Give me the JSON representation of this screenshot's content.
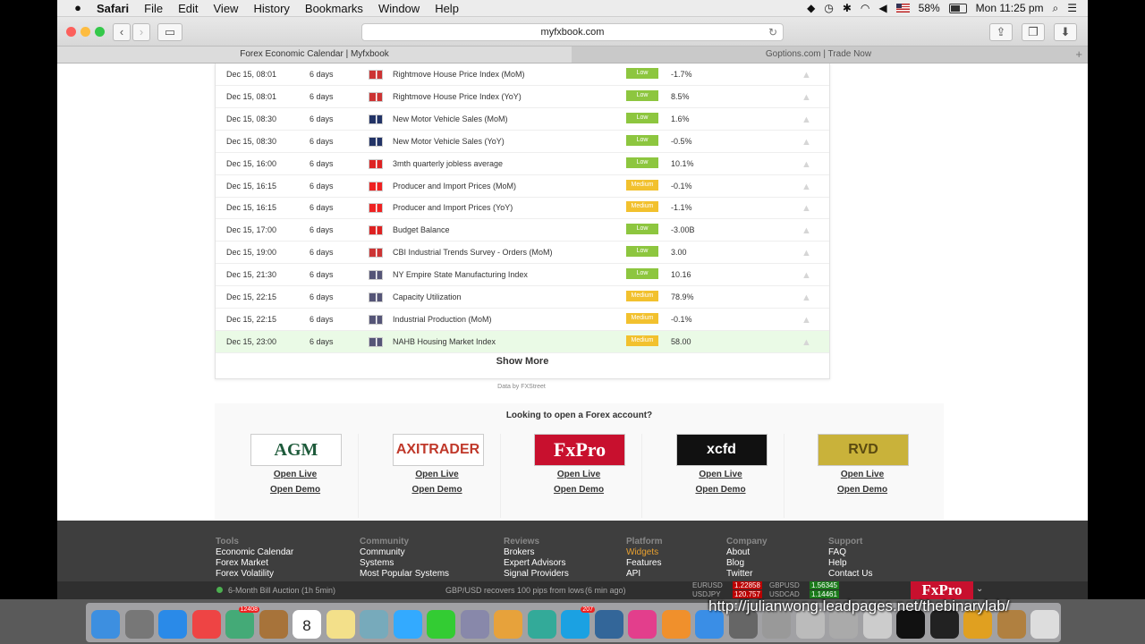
{
  "menubar": {
    "items": [
      "Safari",
      "File",
      "Edit",
      "View",
      "History",
      "Bookmarks",
      "Window",
      "Help"
    ],
    "battery": "58%",
    "clock": "Mon 11:25 pm"
  },
  "toolbar": {
    "url": "myfxbook.com"
  },
  "tabs": [
    "Forex Economic Calendar | Myfxbook",
    "Goptions.com | Trade Now"
  ],
  "calendar": {
    "rows": [
      {
        "date": "Dec 15, 08:01",
        "left": "6 days",
        "event": "Rightmove House Price Index (MoM)",
        "impact": "Low",
        "value": "-1.7%",
        "flag": "#c33"
      },
      {
        "date": "Dec 15, 08:01",
        "left": "6 days",
        "event": "Rightmove House Price Index (YoY)",
        "impact": "Low",
        "value": "8.5%",
        "flag": "#c33"
      },
      {
        "date": "Dec 15, 08:30",
        "left": "6 days",
        "event": "New Motor Vehicle Sales (MoM)",
        "impact": "Low",
        "value": "1.6%",
        "flag": "#236"
      },
      {
        "date": "Dec 15, 08:30",
        "left": "6 days",
        "event": "New Motor Vehicle Sales (YoY)",
        "impact": "Low",
        "value": "-0.5%",
        "flag": "#236"
      },
      {
        "date": "Dec 15, 16:00",
        "left": "6 days",
        "event": "3mth quarterly jobless average",
        "impact": "Low",
        "value": "10.1%",
        "flag": "#d22"
      },
      {
        "date": "Dec 15, 16:15",
        "left": "6 days",
        "event": "Producer and Import Prices (MoM)",
        "impact": "Medium",
        "value": "-0.1%",
        "flag": "#e22"
      },
      {
        "date": "Dec 15, 16:15",
        "left": "6 days",
        "event": "Producer and Import Prices (YoY)",
        "impact": "Medium",
        "value": "-1.1%",
        "flag": "#e22"
      },
      {
        "date": "Dec 15, 17:00",
        "left": "6 days",
        "event": "Budget Balance",
        "impact": "Low",
        "value": "-3.00B",
        "flag": "#d22"
      },
      {
        "date": "Dec 15, 19:00",
        "left": "6 days",
        "event": "CBI Industrial Trends Survey - Orders (MoM)",
        "impact": "Low",
        "value": "3.00",
        "flag": "#c33"
      },
      {
        "date": "Dec 15, 21:30",
        "left": "6 days",
        "event": "NY Empire State Manufacturing Index",
        "impact": "Low",
        "value": "10.16",
        "flag": "#557"
      },
      {
        "date": "Dec 15, 22:15",
        "left": "6 days",
        "event": "Capacity Utilization",
        "impact": "Medium",
        "value": "78.9%",
        "flag": "#557"
      },
      {
        "date": "Dec 15, 22:15",
        "left": "6 days",
        "event": "Industrial Production (MoM)",
        "impact": "Medium",
        "value": "-0.1%",
        "flag": "#557"
      },
      {
        "date": "Dec 15, 23:00",
        "left": "6 days",
        "event": "NAHB Housing Market Index",
        "impact": "Medium",
        "value": "58.00",
        "flag": "#557"
      }
    ],
    "show_more": "Show More",
    "data_by": "Data by FXStreet"
  },
  "colors": {
    "low": "#8dc63f",
    "medium": "#f2c12e"
  },
  "brokers": {
    "title": "Looking to open a Forex account?",
    "items": [
      {
        "name": "AGM",
        "logo_text": "AGM",
        "bg": "#ffffff",
        "fg": "#1d5a3a",
        "live": "Open Live",
        "demo": "Open Demo"
      },
      {
        "name": "AxiTrader",
        "logo_text": "AXITRADER",
        "bg": "#ffffff",
        "fg": "#c0392b",
        "live": "Open Live",
        "demo": "Open Demo"
      },
      {
        "name": "FxPro",
        "logo_text": "FxPro",
        "bg": "#c8102e",
        "fg": "#ffffff",
        "live": "Open Live",
        "demo": "Open Demo"
      },
      {
        "name": "xcfd",
        "logo_text": "xcfd",
        "bg": "#111111",
        "fg": "#ffffff",
        "live": "Open Live",
        "demo": "Open Demo"
      },
      {
        "name": "RVD",
        "logo_text": "RVD",
        "bg": "#c9b23a",
        "fg": "#5a4a10",
        "live": "Open Live",
        "demo": "Open Demo"
      }
    ]
  },
  "footer": {
    "cols": [
      {
        "heading": "Tools",
        "links": [
          "Economic Calendar",
          "Forex Market",
          "Forex Volatility"
        ]
      },
      {
        "heading": "Community",
        "links": [
          "Community",
          "Systems",
          "Most Popular Systems"
        ]
      },
      {
        "heading": "Reviews",
        "links": [
          "Brokers",
          "Expert Advisors",
          "Signal Providers"
        ]
      },
      {
        "heading": "Platform",
        "links": [
          "Widgets",
          "Features",
          "API"
        ]
      },
      {
        "heading": "Company",
        "links": [
          "About",
          "Blog",
          "Twitter"
        ]
      },
      {
        "heading": "Support",
        "links": [
          "FAQ",
          "Help",
          "Contact Us"
        ]
      }
    ]
  },
  "ticker": {
    "news1": "6-Month Bill Auction (1h 5min)",
    "news2": "GBP/USD recovers 100 pips from lows",
    "news2_time": "(6 min ago)",
    "pairs": [
      {
        "name": "EURUSD",
        "value": "1.22858",
        "trend": "down"
      },
      {
        "name": "USDJPY",
        "value": "120.757",
        "trend": "down"
      },
      {
        "name": "GBPUSD",
        "value": "1.56345",
        "trend": "up"
      },
      {
        "name": "USDCAD",
        "value": "1.14461",
        "trend": "up"
      }
    ],
    "brand": "FxPro"
  },
  "dock": {
    "calendar_day": "8",
    "badge1": "12408",
    "badge2": "207",
    "watermark": "http://julianwong.leadpages.net/thebinarylab/"
  }
}
